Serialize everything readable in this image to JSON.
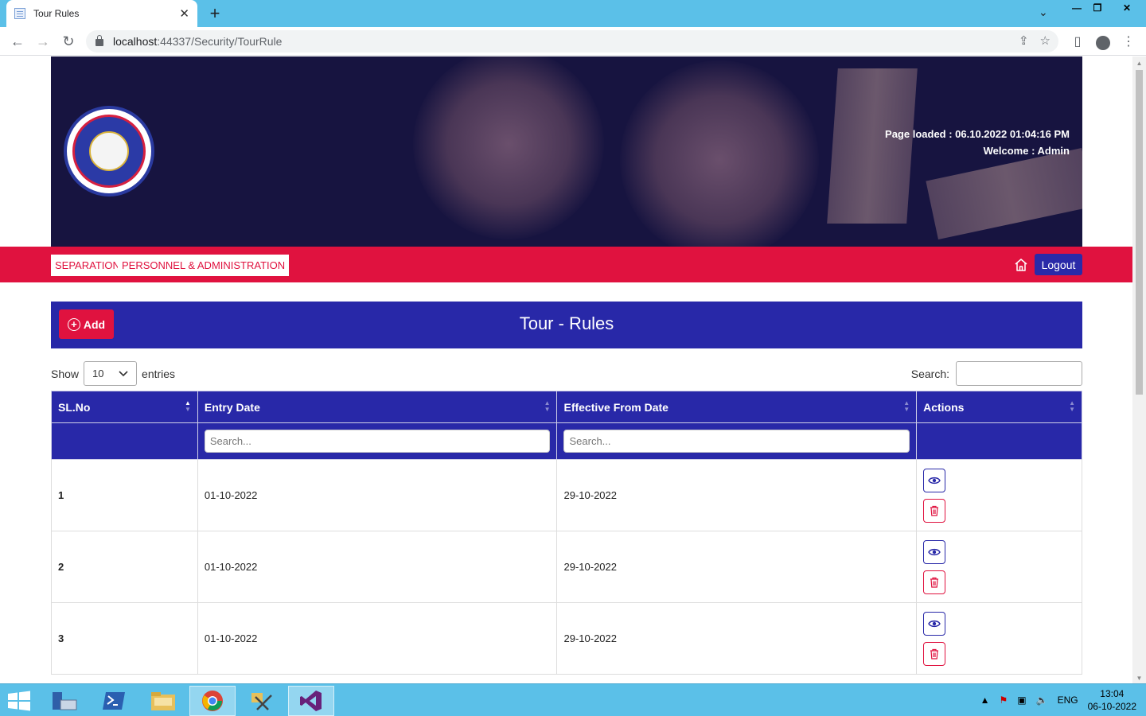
{
  "browser": {
    "tab_title": "Tour Rules",
    "url_host": "localhost",
    "url_rest": ":44337/Security/TourRule"
  },
  "header": {
    "page_loaded_label": "Page loaded : 06.10.2022 01:04:16 PM",
    "welcome_label": "Welcome : ",
    "user": "Admin"
  },
  "menu": {
    "items": [
      "SEPARATION",
      "PERSONNEL & ADMINISTRATION"
    ],
    "logout": "Logout"
  },
  "title_bar": {
    "add_label": "Add",
    "title": "Tour - Rules"
  },
  "table_controls": {
    "show_label": "Show",
    "page_size": "10",
    "entries_label": "entries",
    "search_label": "Search:"
  },
  "table": {
    "columns": [
      "SL.No",
      "Entry Date",
      "Effective From Date",
      "Actions"
    ],
    "filter_placeholder": "Search...",
    "rows": [
      {
        "sl": "1",
        "entry_date": "01-10-2022",
        "effective_from": "29-10-2022"
      },
      {
        "sl": "2",
        "entry_date": "01-10-2022",
        "effective_from": "29-10-2022"
      },
      {
        "sl": "3",
        "entry_date": "01-10-2022",
        "effective_from": "29-10-2022"
      }
    ]
  },
  "taskbar": {
    "language": "ENG",
    "time": "13:04",
    "date": "06-10-2022"
  },
  "colors": {
    "primary_blue": "#2828a8",
    "accent_red": "#e0123f",
    "banner_bg": "#171440",
    "chrome_blue": "#5bc0e8"
  },
  "icons": [
    "home-icon",
    "eye-icon",
    "trash-icon",
    "plus-circle-icon",
    "chevron-down-icon",
    "lock-icon"
  ]
}
